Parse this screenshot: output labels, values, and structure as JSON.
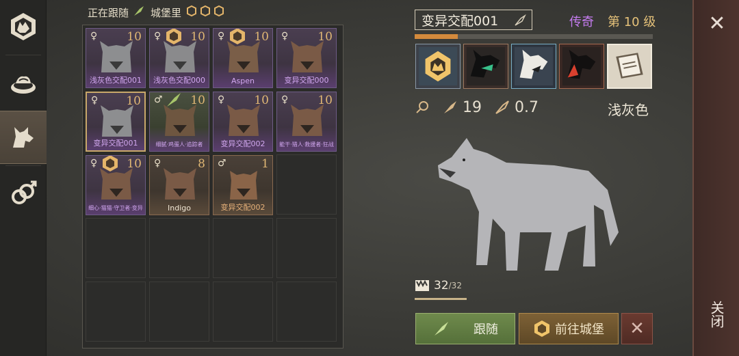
{
  "header": {
    "following_label": "正在跟随",
    "castle_label": "城堡里"
  },
  "wolves": [
    {
      "name": "浅灰色交配001",
      "level": "10",
      "gender": "♀",
      "fur": "grey",
      "rarity": "epic",
      "badge": ""
    },
    {
      "name": "浅灰色交配000",
      "level": "10",
      "gender": "♀",
      "fur": "grey",
      "rarity": "epic",
      "badge": "castle"
    },
    {
      "name": "Aspen",
      "level": "10",
      "gender": "♀",
      "fur": "brown",
      "rarity": "epic",
      "badge": "castle"
    },
    {
      "name": "变异交配000",
      "level": "10",
      "gender": "♀",
      "fur": "brown",
      "rarity": "epic",
      "badge": ""
    },
    {
      "name": "变异交配001",
      "level": "10",
      "gender": "♀",
      "fur": "grey",
      "rarity": "epic",
      "badge": "",
      "selected": true
    },
    {
      "name": "细腻·鸡蛋人·追踪者",
      "level": "10",
      "gender": "♂",
      "fur": "green",
      "rarity": "epic",
      "badge": "follow"
    },
    {
      "name": "变异交配002",
      "level": "10",
      "gender": "♀",
      "fur": "brown",
      "rarity": "epic",
      "badge": ""
    },
    {
      "name": "能干·猎人·救援者·狂战",
      "level": "10",
      "gender": "♀",
      "fur": "brown",
      "rarity": "epic",
      "badge": ""
    },
    {
      "name": "细心·猫猫·守卫者·变异",
      "level": "10",
      "gender": "♀",
      "fur": "brown",
      "rarity": "epic",
      "badge": "castle"
    },
    {
      "name": "Indigo",
      "level": "8",
      "gender": "♀",
      "fur": "brown",
      "rarity": "rare",
      "badge": ""
    },
    {
      "name": "变异交配002",
      "level": "1",
      "gender": "♂",
      "fur": "brown",
      "rarity": "rare",
      "badge": ""
    }
  ],
  "detail": {
    "name": "变异交配001",
    "rarity": "传奇",
    "level": "第 10 级",
    "xp_fraction": 0.18,
    "attack": "19",
    "speed": "0.7",
    "coat": "浅灰色",
    "hp": "32",
    "hp_max": "/32"
  },
  "buttons": {
    "follow": "跟随",
    "castle": "前往城堡",
    "close_vertical": "关闭"
  },
  "icons": [
    "wolf-crest-icon",
    "food-icon",
    "wolf-icon",
    "mating-icon",
    "close-icon",
    "edit-quill-icon"
  ]
}
